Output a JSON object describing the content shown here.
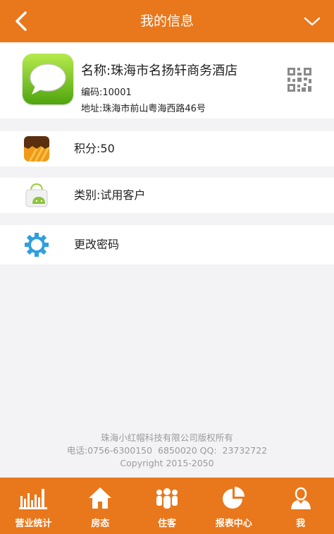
{
  "header": {
    "title": "我的信息"
  },
  "profile": {
    "name": "名称:珠海市名扬轩商务酒店",
    "code": "编码:10001",
    "address": "地址:珠海市前山粤海西路46号"
  },
  "menu": {
    "points": "积分:50",
    "type": "类别:试用客户",
    "change_password": "更改密码"
  },
  "footer": {
    "company": "珠海小红帽科技有限公司版权所有",
    "contact": "电话:0756-6300150  6850020 QQ:  23732722",
    "copyright": "Copyright 2015-2050"
  },
  "tabbar": {
    "items": [
      {
        "label": "营业统计",
        "icon": "bar-chart-icon"
      },
      {
        "label": "房态",
        "icon": "house-icon"
      },
      {
        "label": "住客",
        "icon": "people-icon"
      },
      {
        "label": "报表中心",
        "icon": "pie-chart-icon"
      },
      {
        "label": "我",
        "icon": "user-icon"
      }
    ]
  },
  "colors": {
    "accent": "#e9771b",
    "background": "#f3f3f6",
    "gear": "#2f9fe0"
  }
}
